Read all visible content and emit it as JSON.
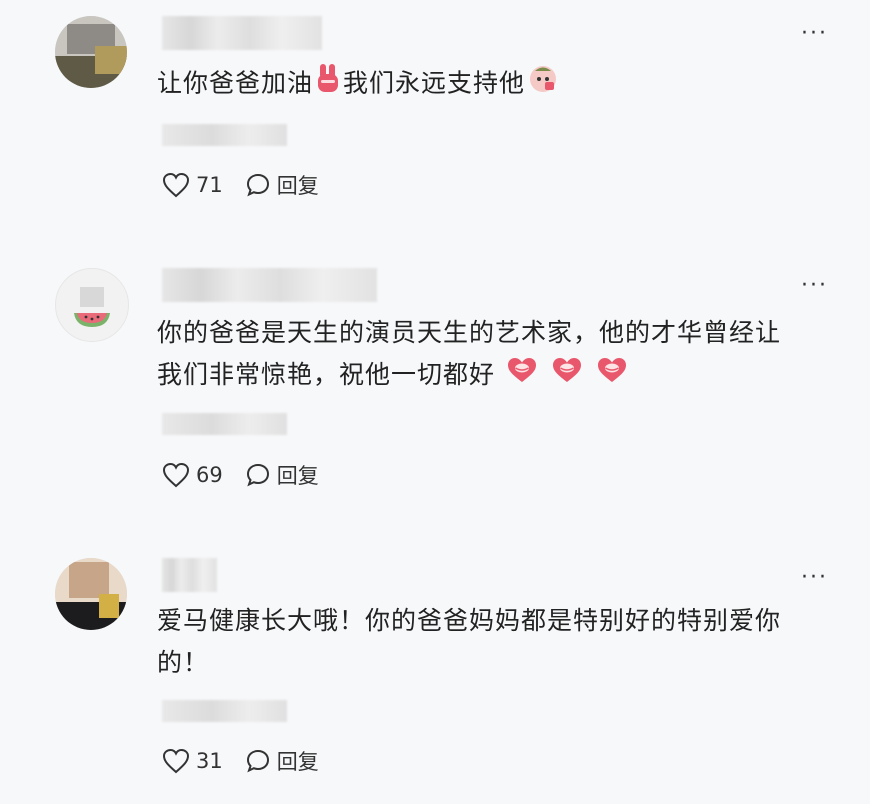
{
  "comments": [
    {
      "text_lines": [
        "让你爸爸加油",
        "我们永远支持他"
      ],
      "emojis": [
        "victory-hand-emoji",
        "face-emoji"
      ],
      "likes": "71",
      "reply_label": "回复",
      "more_label": "···"
    },
    {
      "text_lines": [
        "你的爸爸是天生的演员天生的艺术家，他的才华曾经让",
        "我们非常惊艳，祝他一切都好"
      ],
      "emojis": [
        "heart-lips-emoji",
        "heart-lips-emoji",
        "heart-lips-emoji"
      ],
      "likes": "69",
      "reply_label": "回复",
      "more_label": "···"
    },
    {
      "text_lines": [
        "爱马健康长大哦！你的爸爸妈妈都是特别好的特别爱你",
        "的！"
      ],
      "emojis": [],
      "likes": "31",
      "reply_label": "回复",
      "more_label": "···"
    }
  ],
  "colors": {
    "background": "#f7f8fa",
    "text": "#222222",
    "emoji_pink": "#e8576b"
  }
}
